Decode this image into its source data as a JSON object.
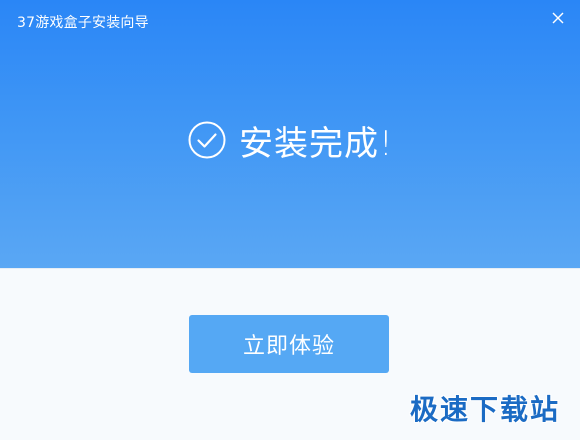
{
  "window": {
    "title": "37游戏盒子安装向导",
    "close_symbol": "×"
  },
  "header": {
    "status_icon": "check-circle-icon",
    "status_text": "安装完成!"
  },
  "actions": {
    "primary_label": "立即体验"
  },
  "watermark": {
    "text": "极速下载站"
  },
  "colors": {
    "header_top": "#2a86f6",
    "header_bottom": "#5aa7f4",
    "button": "#55a8f4",
    "body_background": "#f7fafd",
    "watermark": "#1b6bc4"
  }
}
